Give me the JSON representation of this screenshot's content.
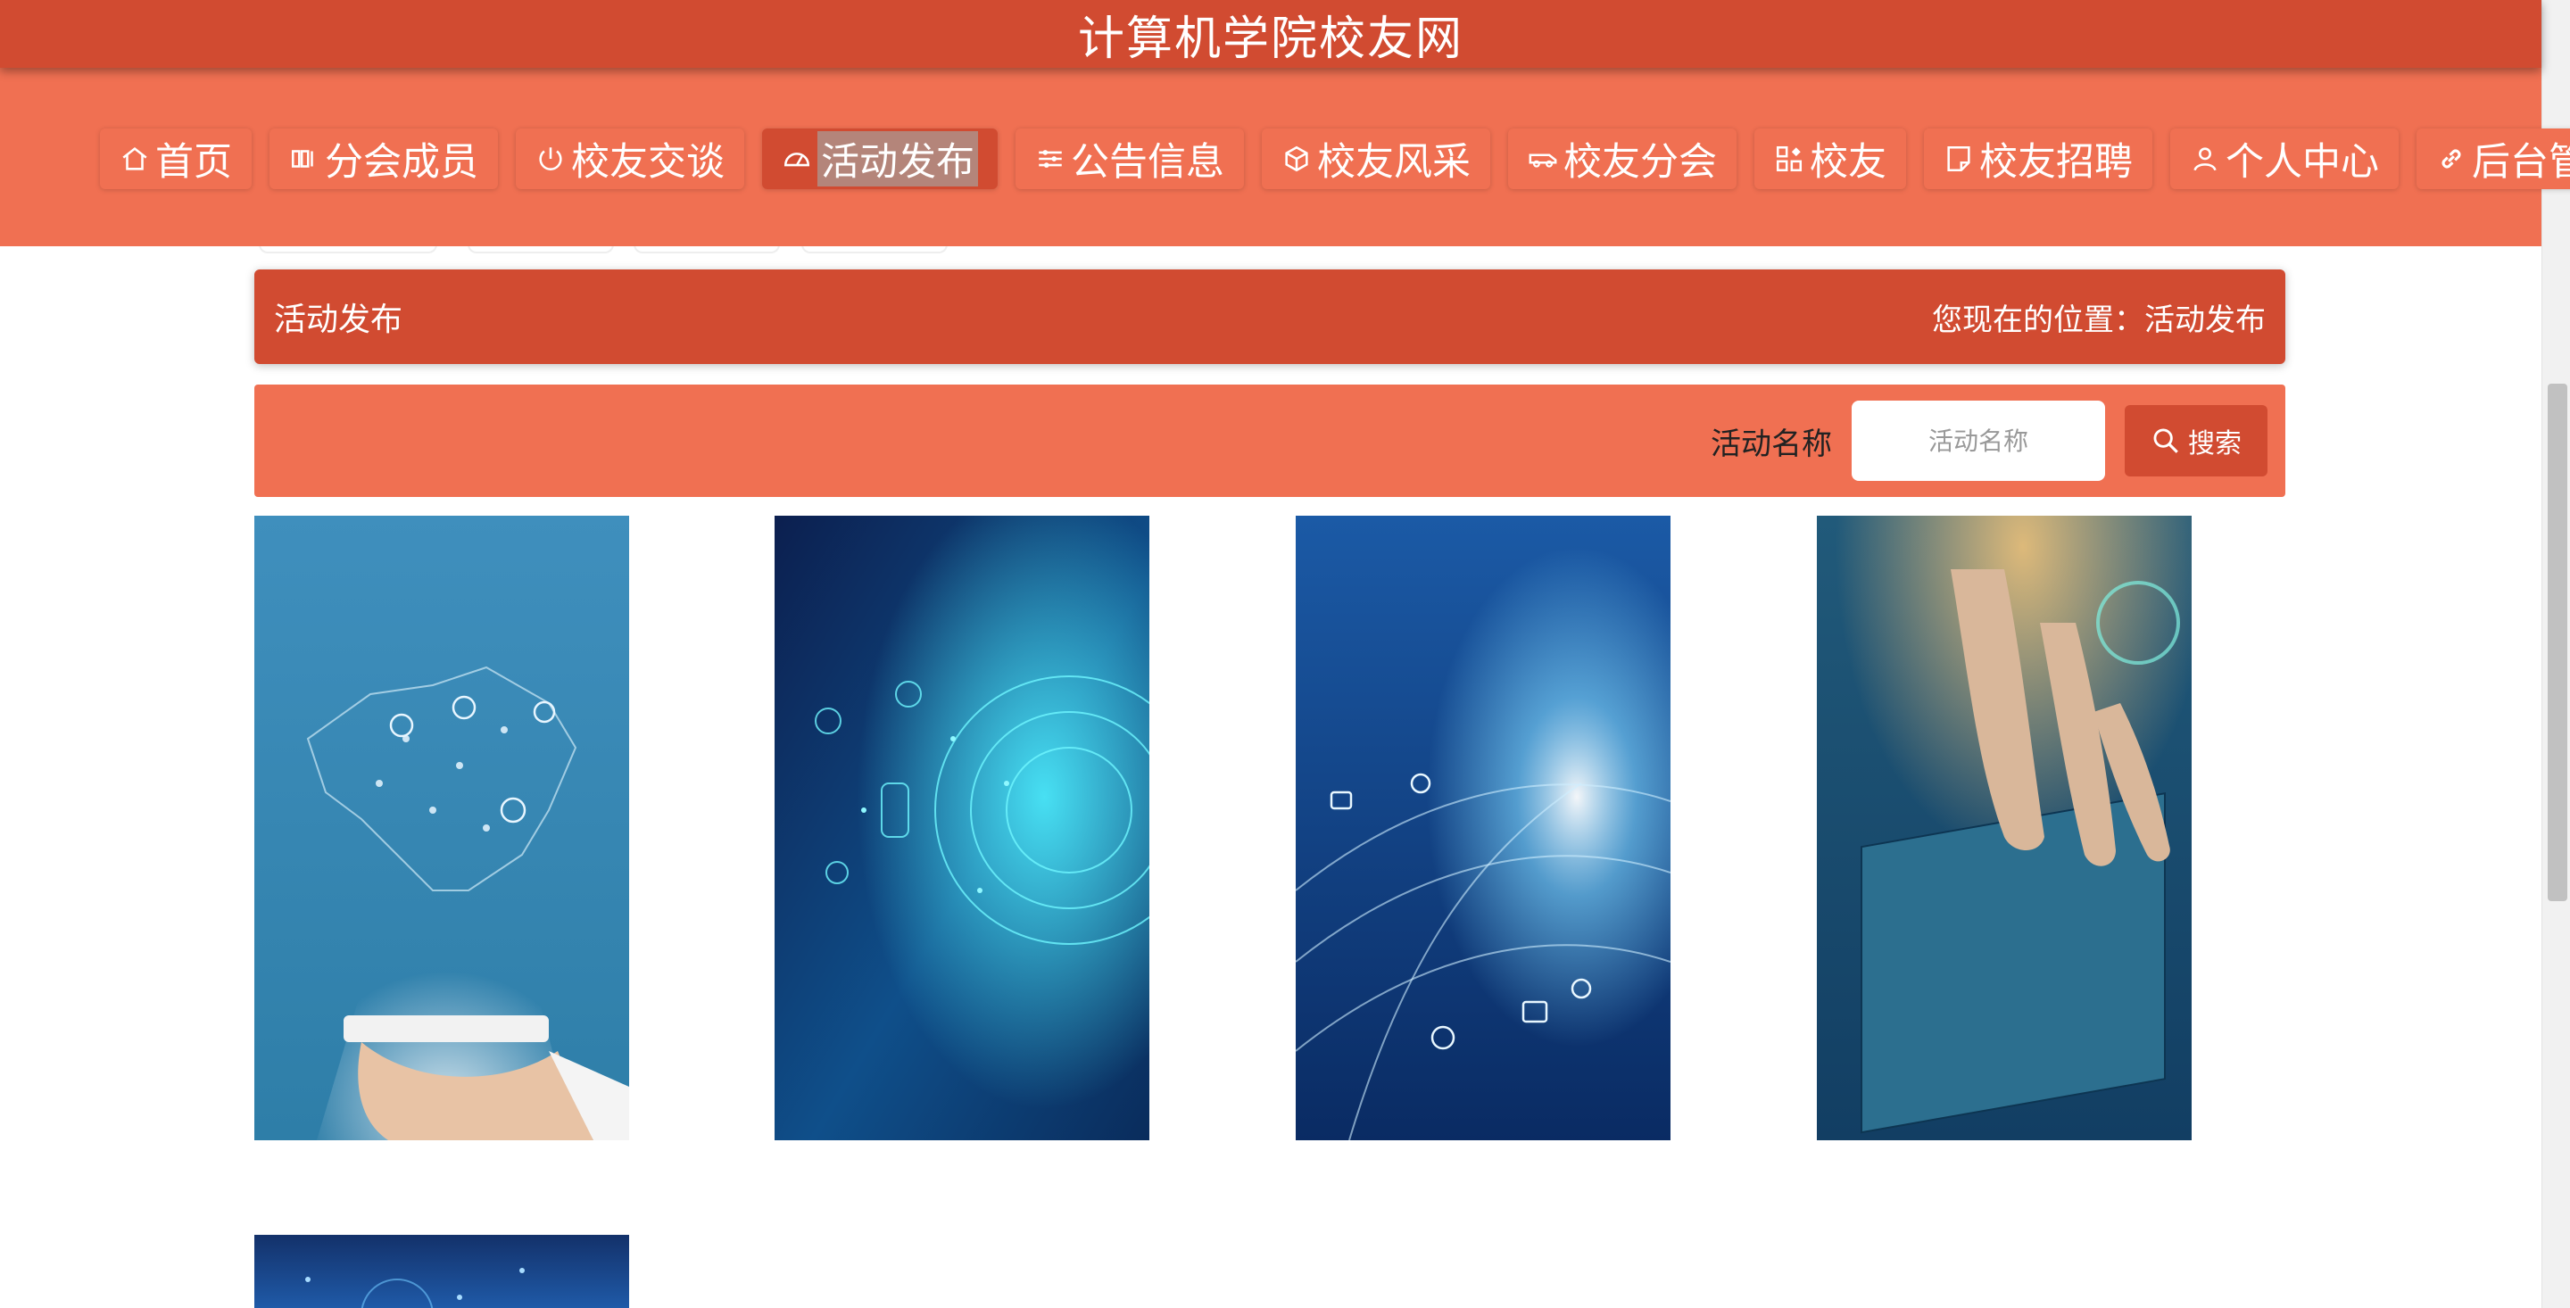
{
  "header": {
    "title": "计算机学院校友网"
  },
  "nav": {
    "items": [
      {
        "label": "首页",
        "icon": "home-icon"
      },
      {
        "label": "分会成员",
        "icon": "members-icon"
      },
      {
        "label": "校友交谈",
        "icon": "power-icon"
      },
      {
        "label": "活动发布",
        "icon": "gauge-icon",
        "active": true
      },
      {
        "label": "公告信息",
        "icon": "sliders-icon"
      },
      {
        "label": "校友风采",
        "icon": "cube-icon"
      },
      {
        "label": "校友分会",
        "icon": "car-icon"
      },
      {
        "label": "校友",
        "icon": "grid-icon"
      },
      {
        "label": "校友招聘",
        "icon": "note-icon"
      },
      {
        "label": "个人中心",
        "icon": "user-icon"
      },
      {
        "label": "后台管理",
        "icon": "link-icon"
      }
    ]
  },
  "breadcrumb": {
    "title": "活动发布",
    "prefix": "您现在的位置：",
    "current": "活动发布"
  },
  "search": {
    "label": "活动名称",
    "placeholder": "活动名称",
    "button_label": "搜索"
  },
  "colors": {
    "primary": "#d14b31",
    "secondary": "#f07052"
  },
  "cards": [
    {
      "image": "tablet-china-network"
    },
    {
      "image": "cyan-tech-circle"
    },
    {
      "image": "blue-network-globe"
    },
    {
      "image": "hands-on-keyboard"
    },
    {
      "image": "blue-tech-partial"
    }
  ]
}
